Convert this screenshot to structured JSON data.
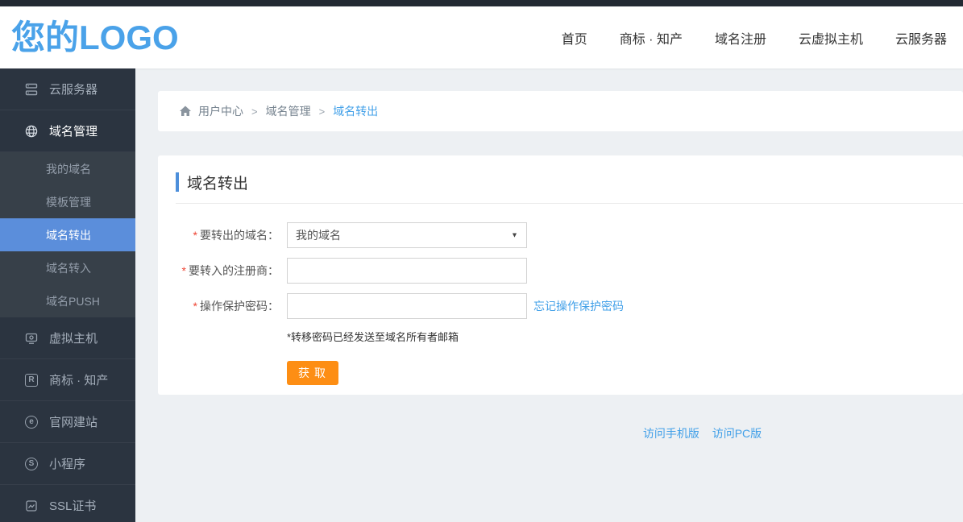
{
  "colors": {
    "topbar_bg": "#232a33",
    "sidebar_bg": "#2b3440",
    "submenu_bg": "#374049",
    "active_item_blue": "#5b8edb",
    "logo_blue": "#4aa2e9",
    "link_blue": "#42a0e8",
    "title_bar_blue": "#4d8fdb",
    "button_orange": "#fd8e14",
    "content_bg": "#edf0f3",
    "required_red": "#e43"
  },
  "header": {
    "logo": "您的LOGO",
    "nav": [
      "首页",
      "商标 · 知产",
      "域名注册",
      "云虚拟主机",
      "云服务器"
    ]
  },
  "sidebar": {
    "items": [
      {
        "label": "云服务器",
        "icon": "server-icon"
      },
      {
        "label": "域名管理",
        "icon": "globe-icon"
      },
      {
        "label": "虚拟主机",
        "icon": "host-icon"
      },
      {
        "label": "商标 · 知产",
        "icon": "trademark-icon",
        "glyph": "R"
      },
      {
        "label": "官网建站",
        "icon": "website-icon",
        "glyph": "e"
      },
      {
        "label": "小程序",
        "icon": "miniprogram-icon",
        "glyph": "S"
      },
      {
        "label": "SSL证书",
        "icon": "certificate-icon"
      }
    ],
    "submenu": {
      "parent": "域名管理",
      "items": [
        "我的域名",
        "模板管理",
        "域名转出",
        "域名转入",
        "域名PUSH"
      ],
      "active": "域名转出"
    }
  },
  "breadcrumb": {
    "separator": ">",
    "items": [
      "用户中心",
      "域名管理",
      "域名转出"
    ]
  },
  "panel": {
    "title": "域名转出",
    "form": {
      "dropdown_arrow": "▼",
      "fields": [
        {
          "required_mark": "*",
          "label": "要转出的域名：",
          "type": "select",
          "value": "我的域名"
        },
        {
          "required_mark": "*",
          "label": "要转入的注册商：",
          "type": "text",
          "value": ""
        },
        {
          "required_mark": "*",
          "label": "操作保护密码：",
          "type": "text",
          "value": "",
          "link": "忘记操作保护密码"
        }
      ],
      "note": "*转移密码已经发送至域名所有者邮箱",
      "submit_label": "获取"
    }
  },
  "footer": {
    "links": [
      "访问手机版",
      "访问PC版"
    ]
  }
}
